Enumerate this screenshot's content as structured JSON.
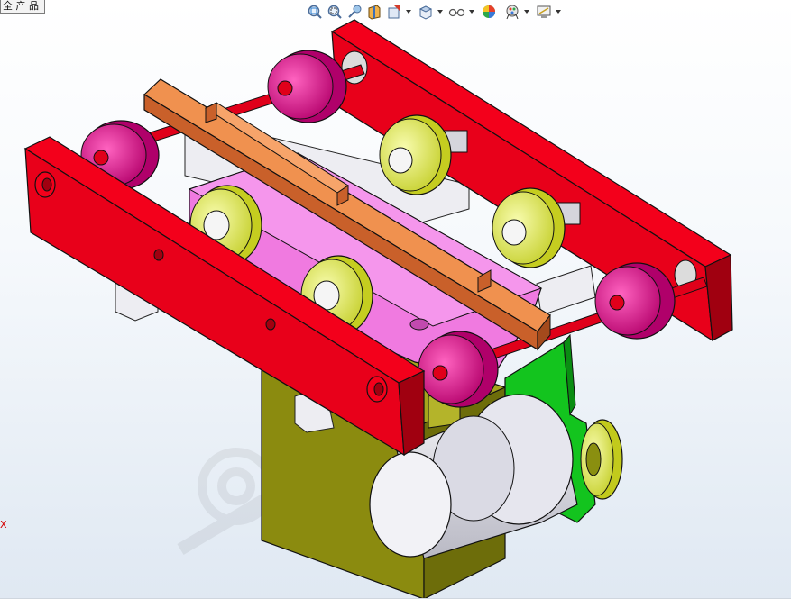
{
  "document_tab": {
    "label": "全 产 品"
  },
  "toolbar": {
    "items": [
      {
        "name": "zoom-to-fit",
        "icon": "zoom-to-fit-icon",
        "dropdown": false
      },
      {
        "name": "zoom-to-area",
        "icon": "zoom-to-area-icon",
        "dropdown": false
      },
      {
        "name": "previous-view",
        "icon": "previous-view-icon",
        "dropdown": false
      },
      {
        "name": "section-view",
        "icon": "section-view-icon",
        "dropdown": false
      },
      {
        "name": "dynamic-annotation",
        "icon": "dynamic-annotation-icon",
        "dropdown": true
      },
      {
        "name": "view-orientation",
        "icon": "view-orientation-icon",
        "dropdown": true
      },
      {
        "name": "display-style",
        "icon": "display-style-icon",
        "dropdown": true
      },
      {
        "name": "hide-show-items",
        "icon": "hide-show-items-icon",
        "dropdown": false
      },
      {
        "name": "edit-appearance",
        "icon": "edit-appearance-icon",
        "dropdown": true
      },
      {
        "name": "apply-scene",
        "icon": "apply-scene-icon",
        "dropdown": true
      },
      {
        "name": "view-settings",
        "icon": "view-settings-icon",
        "dropdown": true
      }
    ]
  },
  "triad": {
    "x_label": "X"
  },
  "colors": {
    "frame": "#e8001a",
    "frame_dark": "#a80010",
    "roller_magenta": "#e0178a",
    "roller_yellow": "#e2ec50",
    "rail_orange": "#e07a3e",
    "slider_pink": "#f07ce0",
    "housing_olive": "#8f8f12",
    "bracket_green": "#10c71f",
    "shaft_red": "#e0001a",
    "motor_gray": "#d8d8e0"
  }
}
